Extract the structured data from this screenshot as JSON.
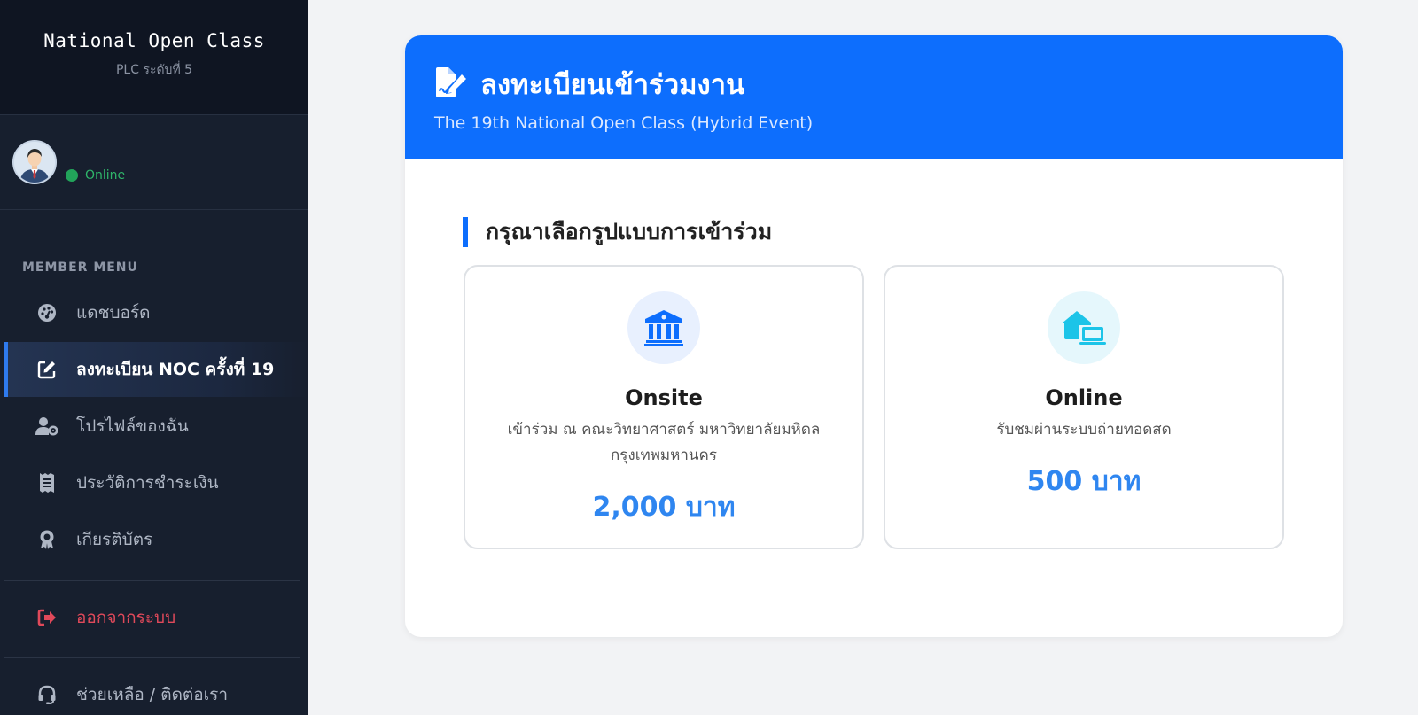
{
  "brand": {
    "title": "National Open Class",
    "subtitle": "PLC ระดับที่ 5"
  },
  "user": {
    "status": "Online"
  },
  "sidebar": {
    "heading": "MEMBER MENU",
    "items": [
      {
        "label": "แดชบอร์ด",
        "icon": "dashboard-icon"
      },
      {
        "label": "ลงทะเบียน NOC ครั้งที่ 19",
        "icon": "edit-icon",
        "active": true
      },
      {
        "label": "โปรไฟล์ของฉัน",
        "icon": "user-gear-icon"
      },
      {
        "label": "ประวัติการชำระเงิน",
        "icon": "receipt-icon"
      },
      {
        "label": "เกียรติบัตร",
        "icon": "award-icon"
      }
    ],
    "logout": "ออกจากระบบ",
    "help": "ช่วยเหลือ / ติดต่อเรา"
  },
  "header": {
    "title": "ลงทะเบียนเข้าร่วมงาน",
    "subtitle": "The 19th National Open Class (Hybrid Event)"
  },
  "section": {
    "title": "กรุณาเลือกรูปแบบการเข้าร่วม"
  },
  "options": [
    {
      "name": "Onsite",
      "description": "เข้าร่วม ณ คณะวิทยาศาสตร์ มหาวิทยาลัยมหิดล กรุงเทพมหานคร",
      "price": "2,000 บาท",
      "icon": "building-columns-icon"
    },
    {
      "name": "Online",
      "description": "รับชมผ่านระบบถ่ายทอดสด",
      "price": "500 บาท",
      "icon": "house-laptop-icon"
    }
  ],
  "colors": {
    "primary": "#0d6efd",
    "sidebar": "#171f2e",
    "price": "#2f86f0",
    "online": "#22a35a",
    "logout": "#e0495a"
  }
}
